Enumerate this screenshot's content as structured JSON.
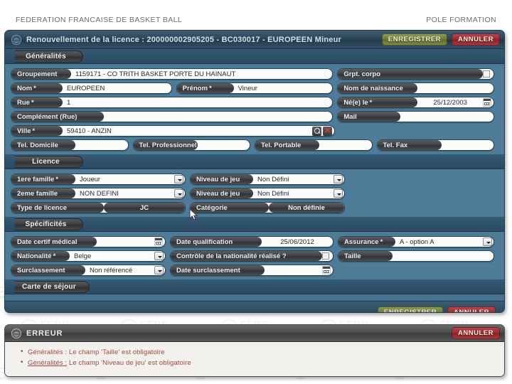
{
  "page_header": {
    "left": "FEDERATION FRANCAISE DE BASKET BALL",
    "right": "POLE FORMATION"
  },
  "watermark": {
    "text": "FFBB"
  },
  "window": {
    "title": "Renouvellement de la licence : 200000002905205 - BC030017 - EUROPEEN Mineur",
    "logo_icon": "ffbb-logo-icon",
    "save_label": "ENREGISTRER",
    "cancel_label": "ANNULER"
  },
  "sections": {
    "generalites": {
      "tab_label": "Généralités"
    },
    "licence": {
      "tab_label": "Licence"
    },
    "specificites": {
      "tab_label": "Spécificités"
    },
    "carte_sejour": {
      "tab_label": "Carte de séjour"
    }
  },
  "fields": {
    "groupement": {
      "label": "Groupement",
      "value": "1159171 - CO TRITH BASKET PORTE DU HAINAUT"
    },
    "grpt_corpo": {
      "label": "Grpt. corpo",
      "checked": false
    },
    "nom": {
      "label": "Nom",
      "required": "*",
      "value": "EUROPEEN"
    },
    "prenom": {
      "label": "Prénom",
      "required": "*",
      "value": "Vineur"
    },
    "nom_naissance": {
      "label": "Nom de naissance",
      "value": ""
    },
    "rue": {
      "label": "Rue",
      "required": "*",
      "value": "1"
    },
    "ne_le": {
      "label": "Né(e) le",
      "required": "*",
      "value": "25/12/2003",
      "icon": "calendar-icon"
    },
    "complement_rue": {
      "label": "Complément (Rue)",
      "value": ""
    },
    "mail": {
      "label": "Mail",
      "value": ""
    },
    "ville": {
      "label": "Ville",
      "required": "*",
      "value": "59410 - ANZIN",
      "search_icon": "search-icon",
      "clear_icon": "clear-icon"
    },
    "tel_domicile": {
      "label": "Tel. Domicile",
      "value": ""
    },
    "tel_professionnel": {
      "label": "Tel. Professionnel",
      "value": ""
    },
    "tel_portable": {
      "label": "Tel. Portable",
      "value": ""
    },
    "tel_fax": {
      "label": "Tel. Fax",
      "value": ""
    },
    "famille1": {
      "label": "1ere famille",
      "required": "*",
      "value": "Joueur"
    },
    "niveau_jeu1": {
      "label": "Niveau de jeu",
      "value": "Non Défini"
    },
    "famille2": {
      "label": "2eme famille",
      "value": "NON DEFINI"
    },
    "niveau_jeu2": {
      "label": "Niveau de jeu",
      "value": "Non Défini"
    },
    "type_licence": {
      "label": "Type de licence",
      "value": "JC"
    },
    "categorie": {
      "label": "Catégorie",
      "value": "Non définie"
    },
    "date_certif": {
      "label": "Date certif médical",
      "value": "",
      "icon": "calendar-icon"
    },
    "date_qualif": {
      "label": "Date qualification",
      "value": "25/06/2012"
    },
    "assurance": {
      "label": "Assurance",
      "required": "*",
      "value": "A - option A"
    },
    "nationalite": {
      "label": "Nationalité",
      "required": "*",
      "value": "Belge"
    },
    "controle_nat": {
      "label": "Contrôle de la nationalité réalisé ?",
      "checked": false
    },
    "taille": {
      "label": "Taille",
      "value": ""
    },
    "surclassement": {
      "label": "Surclassement",
      "value": "Non référencé"
    },
    "date_surclassement": {
      "label": "Date surclassement",
      "value": "",
      "icon": "calendar-icon"
    }
  },
  "footer": {
    "save_label": "ENREGISTRER",
    "cancel_label": "ANNULER"
  },
  "error_window": {
    "title": "ERREUR",
    "logo_icon": "ffbb-logo-icon",
    "cancel_label": "ANNULER",
    "messages": [
      {
        "link": "Généralités :",
        "text": " Le champ 'Taille' est obligatoire",
        "underlined": false
      },
      {
        "link": "Généralités :",
        "text": " Le champ 'Niveau de jeu' est obligatoire",
        "underlined": true
      }
    ]
  },
  "colors": {
    "window_body": "#4e7b98",
    "titlebar": "#2c4659",
    "save_button": "#6e7b36",
    "cancel_button": "#97292f",
    "error_text": "#9e4a42"
  }
}
